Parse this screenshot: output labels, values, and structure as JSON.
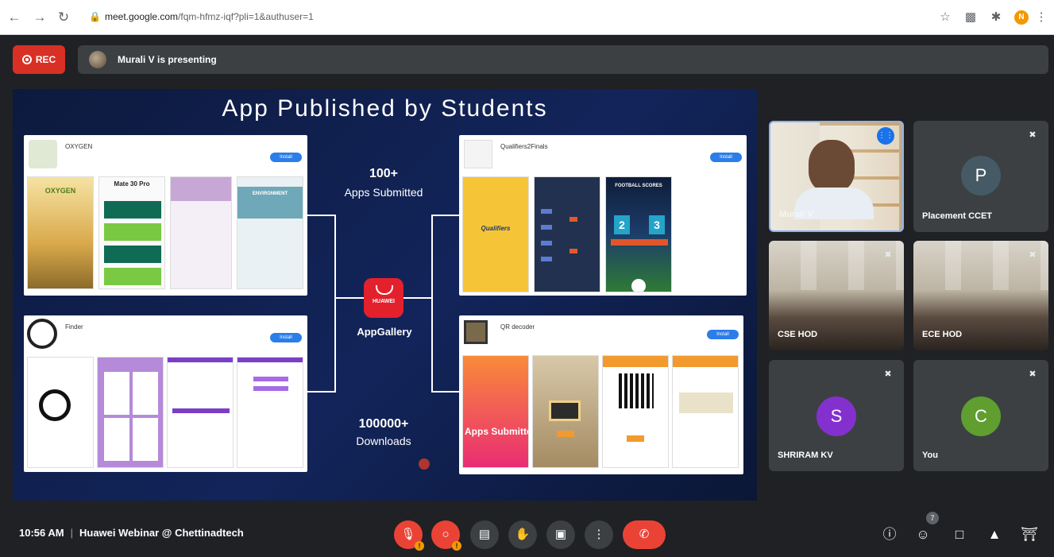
{
  "browser": {
    "url_host": "meet.google.com",
    "url_path": "/fqm-hfmz-iqf?pli=1&authuser=1",
    "profile_initial": "N"
  },
  "meet": {
    "rec_label": "REC",
    "presenting_text": "Murali V is presenting"
  },
  "slide": {
    "title": "App Published by Students",
    "apps_count": "100+",
    "apps_label": "Apps Submitted",
    "downloads_count": "100000+",
    "downloads_label": "Downloads",
    "store_brand": "HUAWEI",
    "store_name": "AppGallery",
    "cards": [
      {
        "name": "OXYGEN",
        "install": "Install",
        "shots": [
          "OXYGEN",
          "Mate 30 Pro",
          "",
          "ENVIRONMENT"
        ]
      },
      {
        "name": "Qualifiers2Finals",
        "install": "Install",
        "shots": [
          "Qualifiers",
          "",
          "FOOTBALL SCORES",
          ""
        ]
      },
      {
        "name": "Finder",
        "install": "Install",
        "shots": [
          "",
          "",
          "",
          ""
        ]
      },
      {
        "name": "QR decoder",
        "install": "Install",
        "shots": [
          "Apps Submitted",
          "",
          "",
          ""
        ]
      }
    ]
  },
  "participants": [
    {
      "name": "Murali V",
      "initial": ""
    },
    {
      "name": "Placement CCET",
      "initial": "P",
      "color": "#455a64"
    },
    {
      "name": "CSE HOD",
      "initial": ""
    },
    {
      "name": "ECE HOD",
      "initial": ""
    },
    {
      "name": "SHRIRAM KV",
      "initial": "S",
      "color": "#8430ce"
    },
    {
      "name": "You",
      "initial": "C",
      "color": "#5f9e2f"
    }
  ],
  "bottom": {
    "time": "10:56 AM",
    "meeting_name": "Huawei Webinar @ Chettinadtech",
    "participant_count": "7"
  },
  "colors": {
    "meet_bg": "#202124",
    "tile_bg": "#3c4043",
    "red": "#ea4335",
    "blue": "#1a73e8"
  }
}
